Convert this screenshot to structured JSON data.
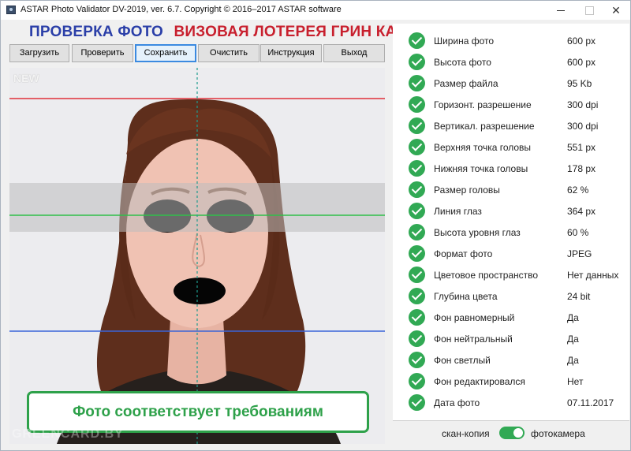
{
  "window": {
    "title": "ASTAR Photo Validator DV-2019, ver. 6.7.  Copyright © 2016–2017 ASTAR software",
    "minimize_glyph": "",
    "maximize_glyph": "",
    "close_glyph": "✕"
  },
  "heading": {
    "part1": "ПРОВЕРКА ФОТО",
    "part2": "ВИЗОВАЯ ЛОТЕРЕЯ ГРИН КАРТА"
  },
  "toolbar": {
    "load": "Загрузить",
    "check": "Проверить",
    "save": "Сохранить",
    "clear": "Очистить",
    "instructions": "Инструкция",
    "exit": "Выход"
  },
  "photo": {
    "new_label": "NEW",
    "status_message": "Фото соответствует требованиям",
    "watermark": "GREENCARD.BY"
  },
  "results": [
    {
      "param": "Ширина фото",
      "value": "600 px",
      "status": "ok"
    },
    {
      "param": "Высота фото",
      "value": "600 px",
      "status": "ok"
    },
    {
      "param": "Размер файла",
      "value": "95 Kb",
      "status": "ok"
    },
    {
      "param": "Горизонт. разрешение",
      "value": "300 dpi",
      "status": "ok"
    },
    {
      "param": "Вертикал. разрешение",
      "value": "300 dpi",
      "status": "ok"
    },
    {
      "param": "Верхняя точка головы",
      "value": "551 px",
      "status": "ok"
    },
    {
      "param": "Нижняя точка головы",
      "value": "178 px",
      "status": "ok"
    },
    {
      "param": "Размер головы",
      "value": "62 %",
      "status": "ok"
    },
    {
      "param": "Линия глаз",
      "value": "364 px",
      "status": "ok"
    },
    {
      "param": "Высота уровня глаз",
      "value": "60 %",
      "status": "ok"
    },
    {
      "param": "Формат фото",
      "value": "JPEG",
      "status": "ok"
    },
    {
      "param": "Цветовое пространство",
      "value": "Нет данных",
      "status": "ok"
    },
    {
      "param": "Глубина цвета",
      "value": "24 bit",
      "status": "ok"
    },
    {
      "param": "Фон равномерный",
      "value": "Да",
      "status": "ok"
    },
    {
      "param": "Фон нейтральный",
      "value": "Да",
      "status": "ok"
    },
    {
      "param": "Фон светлый",
      "value": "Да",
      "status": "ok"
    },
    {
      "param": "Фон редактировался",
      "value": "Нет",
      "status": "ok"
    },
    {
      "param": "Дата фото",
      "value": "07.11.2017",
      "status": "ok"
    }
  ],
  "footer": {
    "scan_label": "скан-копия",
    "camera_label": "фотокамера",
    "mode_camera": true
  },
  "colors": {
    "heading_blue": "#2b3fa8",
    "heading_red": "#c8202e",
    "ok_green": "#31a954",
    "top_line_red": "#e0303a",
    "eye_line_green": "#2fbf4a",
    "bottom_line_blue": "#3a64d8",
    "center_line_teal": "#1f9b8e"
  }
}
